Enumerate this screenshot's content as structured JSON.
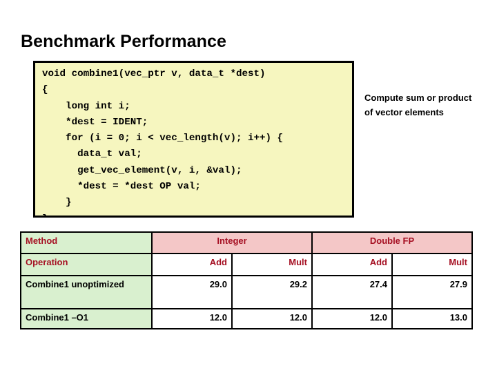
{
  "slide": {
    "title": "Benchmark Performance"
  },
  "code": {
    "language": "c",
    "text": "void combine1(vec_ptr v, data_t *dest)\n{\n    long int i;\n    *dest = IDENT;\n    for (i = 0; i < vec_length(v); i++) {\n      data_t val;\n      get_vec_element(v, i, &val);\n      *dest = *dest OP val;\n    }\n}",
    "background_color": "#f6f6bf",
    "border_color": "#000000"
  },
  "annotation": {
    "text": "Compute sum or product of vector elements"
  },
  "table": {
    "header": {
      "method_label": "Method",
      "groups": [
        {
          "label": "Integer",
          "span": 2
        },
        {
          "label": "Double FP",
          "span": 2
        }
      ]
    },
    "operation_row": {
      "label": "Operation",
      "values": [
        "Add",
        "Mult",
        "Add",
        "Mult"
      ]
    },
    "rows": [
      {
        "label": "Combine1 unoptimized",
        "values": [
          "29.0",
          "29.2",
          "27.4",
          "27.9"
        ]
      },
      {
        "label": "Combine1 –O1",
        "values": [
          "12.0",
          "12.0",
          "12.0",
          "13.0"
        ]
      }
    ],
    "colors": {
      "method_cell": "#d9f0cf",
      "group_cell": "#f4c7c7",
      "header_text": "#a50f22",
      "value_text": "#000000",
      "border": "#000000"
    }
  }
}
